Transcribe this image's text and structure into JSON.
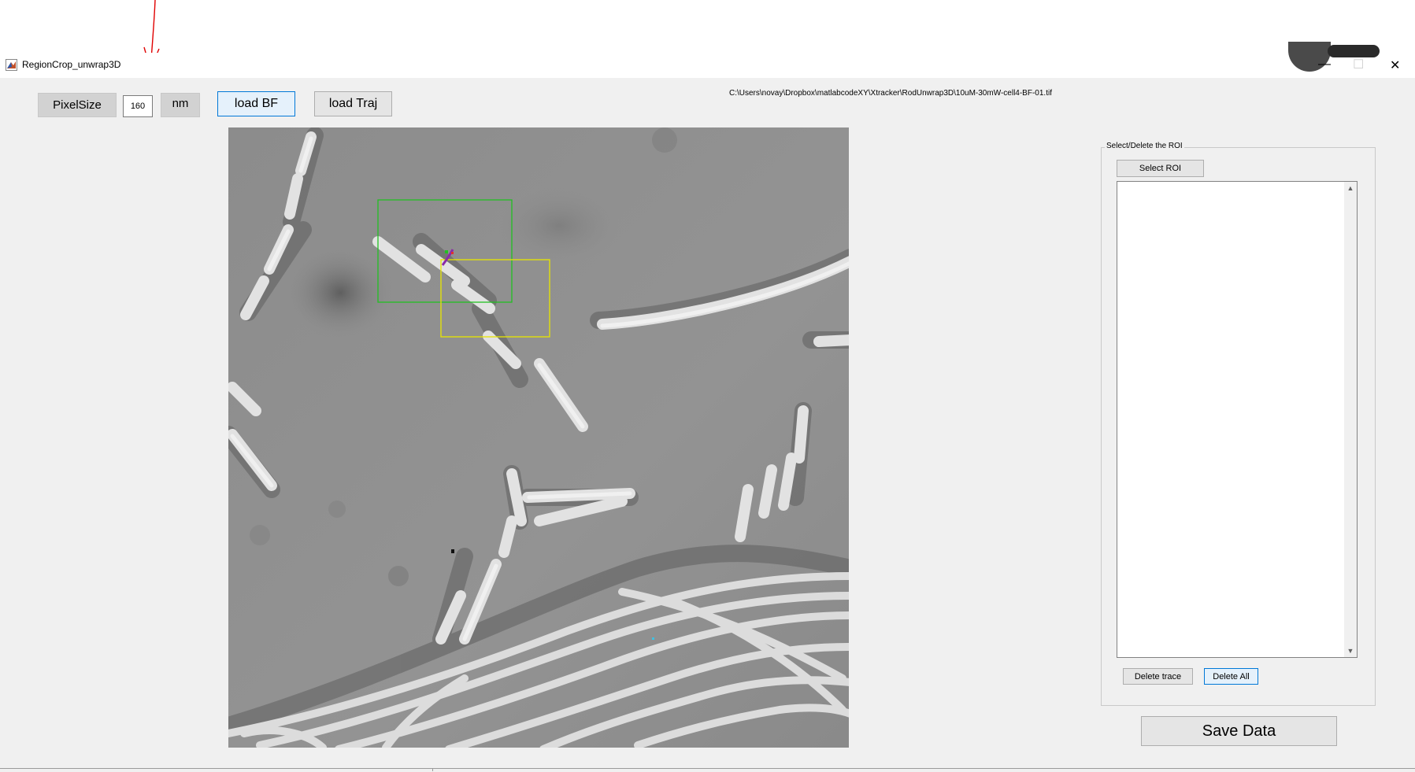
{
  "window": {
    "title": "RegionCrop_unwrap3D",
    "controls": {
      "minimize": "—",
      "maximize": "☐",
      "close": "✕"
    }
  },
  "toolbar": {
    "pixelsize_label": "PixelSize",
    "pixelsize_value": "160",
    "unit_label": "nm",
    "load_bf_label": "load BF",
    "load_traj_label": "load Traj"
  },
  "file_path": "C:\\Users\\novay\\Dropbox\\matlabcodeXY\\Xtracker\\RodUnwrap3D\\10uM-30mW-cell4-BF-01.tif",
  "roi_panel": {
    "legend": "Select/Delete the ROI",
    "select_roi_label": "Select ROI",
    "delete_trace_label": "Delete trace",
    "delete_all_label": "Delete  All",
    "list_items": []
  },
  "save_label": "Save Data",
  "image": {
    "description_icon": "microscope-brightfield-image",
    "roi_colors": {
      "green": "#22c022",
      "yellow": "#e8e600"
    }
  },
  "colors": {
    "window_bg": "#f0f0f0",
    "annotation_arrow": "#e00000",
    "focus_border": "#0078d7"
  }
}
